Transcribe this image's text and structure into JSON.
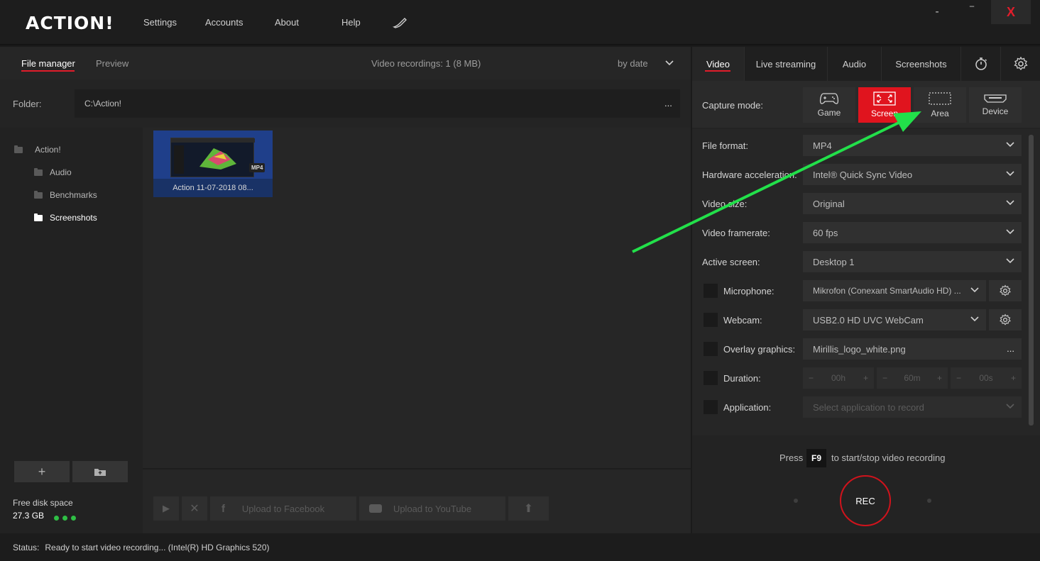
{
  "app": {
    "logo": "ACTION!"
  },
  "menu": {
    "settings": "Settings",
    "accounts": "Accounts",
    "about": "About",
    "help": "Help"
  },
  "window": {
    "minimize": "-",
    "maximize": "‾",
    "close": "X"
  },
  "left_tabs": {
    "file_manager": "File manager",
    "preview": "Preview"
  },
  "recordings_info": "Video recordings: 1 (8 MB)",
  "sort": {
    "label": "by date"
  },
  "folder": {
    "label": "Folder:",
    "path": "C:\\Action!",
    "browse": "..."
  },
  "tree": {
    "items": [
      {
        "label": "Action!"
      },
      {
        "label": "Audio"
      },
      {
        "label": "Benchmarks"
      },
      {
        "label": "Screenshots"
      }
    ]
  },
  "file": {
    "caption": "Action 11-07-2018 08...",
    "badge": "MP4"
  },
  "disk": {
    "label": "Free disk space",
    "value": "27.3 GB"
  },
  "actions": {
    "facebook": "Upload to Facebook",
    "youtube": "Upload to YouTube"
  },
  "right_tabs": {
    "video": "Video",
    "live": "Live streaming",
    "audio": "Audio",
    "screenshots": "Screenshots"
  },
  "capture": {
    "label": "Capture mode:",
    "modes": [
      {
        "label": "Game"
      },
      {
        "label": "Screen"
      },
      {
        "label": "Area"
      },
      {
        "label": "Device"
      }
    ]
  },
  "settings": {
    "file_format": {
      "label": "File format:",
      "value": "MP4"
    },
    "hw_accel": {
      "label": "Hardware acceleration:",
      "value": "Intel® Quick Sync Video"
    },
    "video_size": {
      "label": "Video size:",
      "value": "Original"
    },
    "framerate": {
      "label": "Video framerate:",
      "value": "60 fps"
    },
    "active_screen": {
      "label": "Active screen:",
      "value": "Desktop 1"
    },
    "microphone": {
      "label": "Microphone:",
      "value": "Mikrofon (Conexant SmartAudio HD)  ..."
    },
    "webcam": {
      "label": "Webcam:",
      "value": "USB2.0 HD UVC WebCam"
    },
    "overlay": {
      "label": "Overlay graphics:",
      "value": "Mirillis_logo_white.png",
      "browse": "..."
    },
    "duration": {
      "label": "Duration:",
      "hours": "00h",
      "minutes": "60m",
      "seconds": "00s"
    },
    "application": {
      "label": "Application:",
      "placeholder": "Select application to record"
    }
  },
  "record": {
    "press": "Press",
    "key": "F9",
    "hint": "to start/stop video recording",
    "button": "REC"
  },
  "status": {
    "label": "Status:",
    "text": "Ready to start video recording... (Intel(R) HD Graphics 520)"
  },
  "colors": {
    "accent": "#e0141e",
    "annotation_arrow": "#22e04a"
  }
}
